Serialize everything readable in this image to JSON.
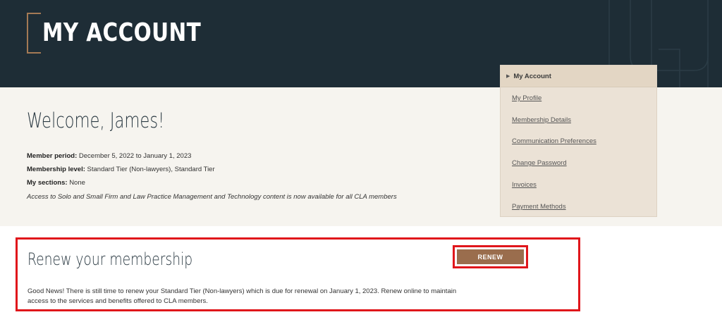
{
  "header": {
    "title": "MY ACCOUNT"
  },
  "welcome": {
    "heading": "Welcome, James!",
    "member_period_label": "Member period:",
    "member_period_value": "December 5, 2022 to January 1, 2023",
    "membership_level_label": "Membership level:",
    "membership_level_value": "Standard Tier (Non-lawyers), Standard Tier",
    "sections_label": "My sections:",
    "sections_value": "None",
    "note": "Access to Solo and Small Firm and Law Practice Management and Technology content is now available for all CLA members"
  },
  "side_menu": {
    "active": "My Account",
    "items": [
      "My Profile",
      "Membership Details",
      "Communication Preferences",
      "Change Password",
      "Invoices",
      "Payment Methods"
    ]
  },
  "renew": {
    "heading": "Renew your membership",
    "button_label": "RENEW",
    "text": "Good News! There is still time to renew your Standard Tier (Non-lawyers) which is due for renewal on January 1, 2023. Renew online to maintain access to the services and benefits offered to CLA members."
  },
  "colors": {
    "header_bg": "#1e2d36",
    "accent_bronze": "#9a6d4d",
    "highlight_red": "#e0161b",
    "menu_bg": "#ebe2d6"
  }
}
